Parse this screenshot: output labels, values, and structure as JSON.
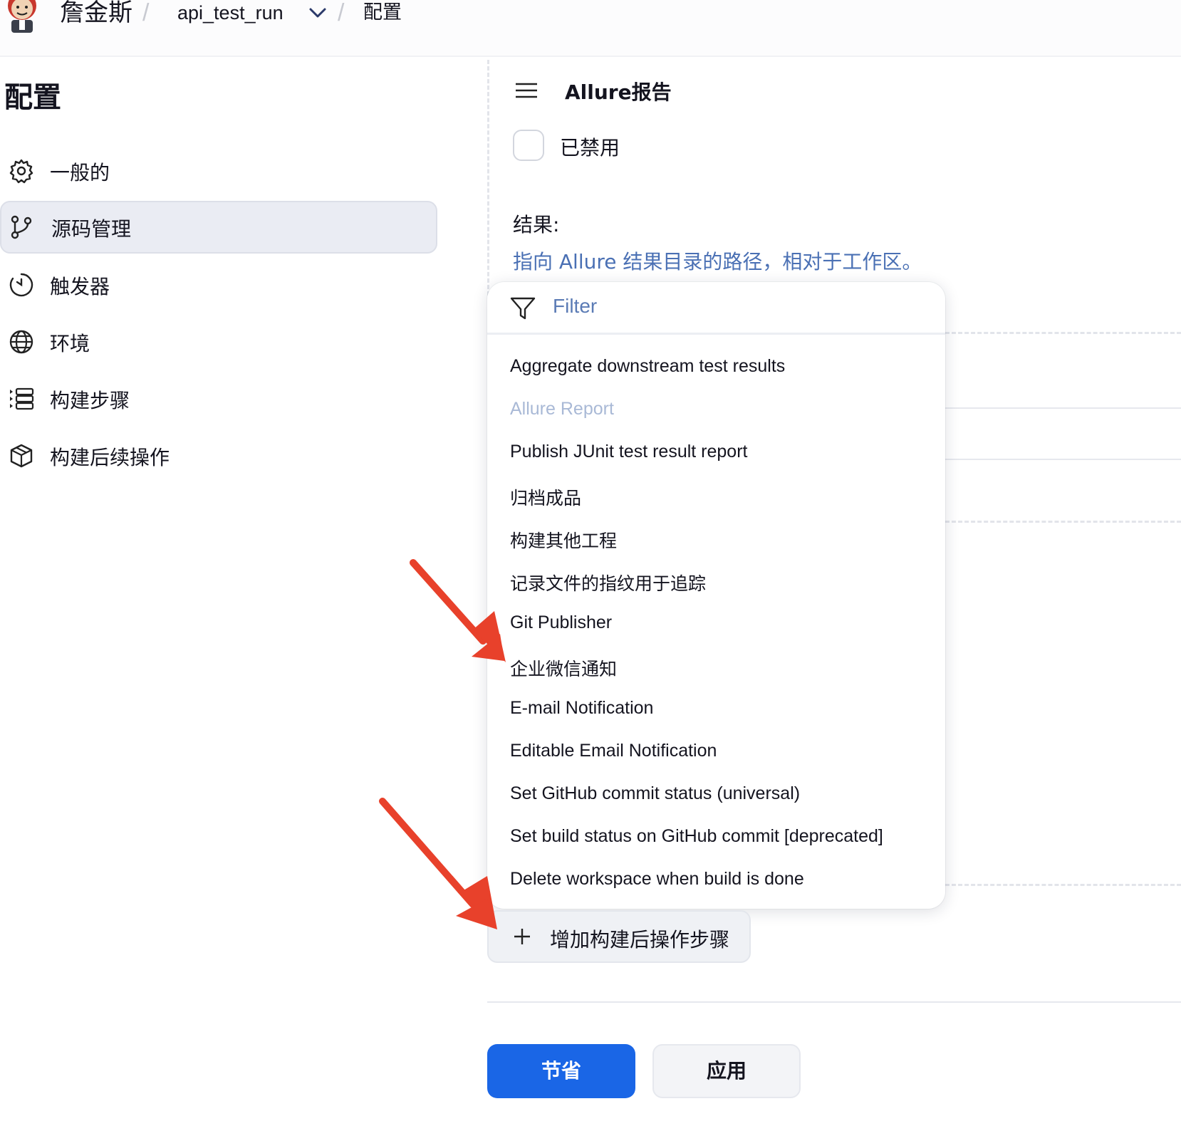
{
  "header": {
    "brand": "詹金斯",
    "job_name": "api_test_run",
    "page_name": "配置",
    "separator": "/"
  },
  "sidebar": {
    "title": "配置",
    "active_index": 1,
    "items": [
      {
        "label": "一般的",
        "icon": "gear-icon"
      },
      {
        "label": "源码管理",
        "icon": "git-branch-icon"
      },
      {
        "label": "触发器",
        "icon": "clock-icon"
      },
      {
        "label": "环境",
        "icon": "globe-icon"
      },
      {
        "label": "构建步骤",
        "icon": "list-icon"
      },
      {
        "label": "构建后续操作",
        "icon": "package-icon"
      }
    ]
  },
  "section": {
    "title": "Allure报告",
    "disabled_label": "已禁用",
    "disabled_checked": false,
    "results_label": "结果:",
    "results_help": "指向 Allure 结果目录的路径，相对于工作区。"
  },
  "dropdown": {
    "filter_placeholder": "Filter",
    "items": [
      {
        "label": "Aggregate downstream test results",
        "disabled": false
      },
      {
        "label": "Allure Report",
        "disabled": true
      },
      {
        "label": "Publish JUnit test result report",
        "disabled": false
      },
      {
        "label": "归档成品",
        "disabled": false
      },
      {
        "label": "构建其他工程",
        "disabled": false
      },
      {
        "label": "记录文件的指纹用于追踪",
        "disabled": false
      },
      {
        "label": "Git Publisher",
        "disabled": false
      },
      {
        "label": "企业微信通知",
        "disabled": false
      },
      {
        "label": "E-mail Notification",
        "disabled": false
      },
      {
        "label": "Editable Email Notification",
        "disabled": false
      },
      {
        "label": "Set GitHub commit status (universal)",
        "disabled": false
      },
      {
        "label": "Set build status on GitHub commit [deprecated]",
        "disabled": false
      },
      {
        "label": "Delete workspace when build is done",
        "disabled": false
      }
    ]
  },
  "add_step_button": "增加构建后操作步骤",
  "buttons": {
    "save": "节省",
    "apply": "应用"
  },
  "colors": {
    "primary": "#1a66e6",
    "annotation_arrow": "#e8412b",
    "help_text": "#4a70b4"
  }
}
